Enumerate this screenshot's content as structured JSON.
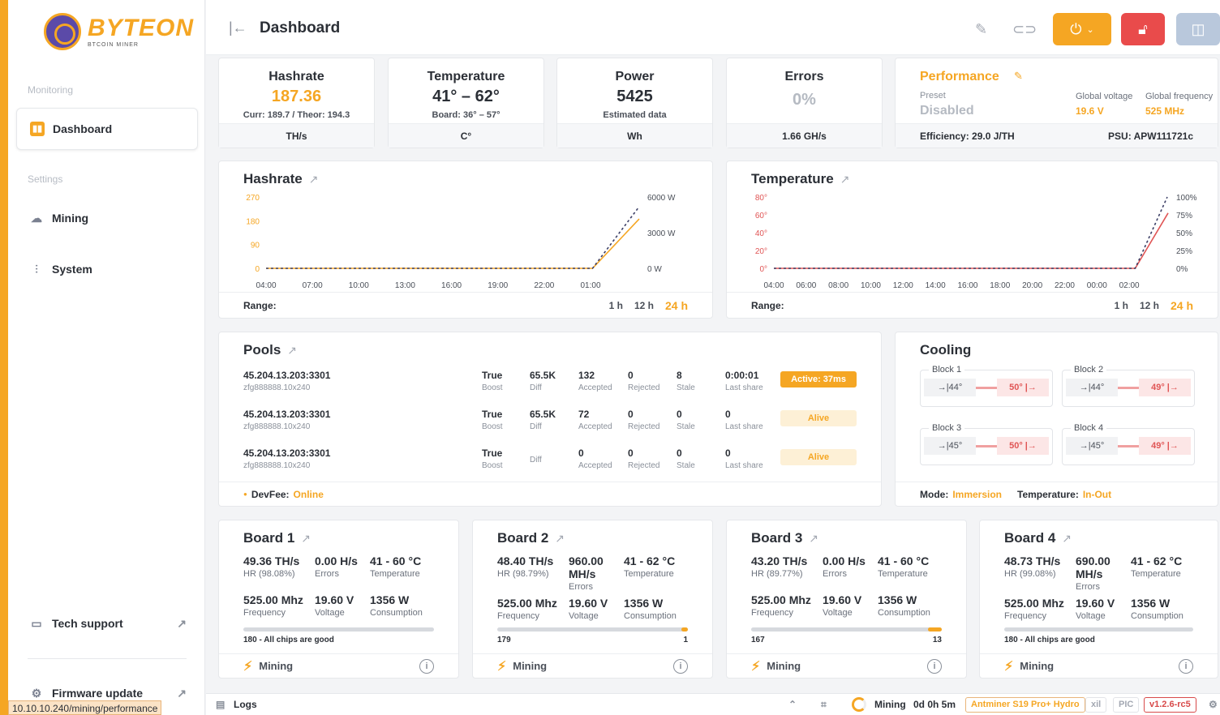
{
  "sidebar": {
    "logo_text": "BYTEON",
    "logo_sub": "BTCOIN MINER",
    "section_monitoring": "Monitoring",
    "section_settings": "Settings",
    "items": [
      {
        "label": "Dashboard",
        "icon": "chart-icon"
      },
      {
        "label": "Mining",
        "icon": "cloud-icon"
      },
      {
        "label": "System",
        "icon": "sliders-icon"
      },
      {
        "label": "Tech support",
        "icon": "chat-icon"
      },
      {
        "label": "Firmware update",
        "icon": "chip-icon"
      }
    ],
    "status_url": "10.10.10.240/mining/performance"
  },
  "header": {
    "title": "Dashboard"
  },
  "stats": {
    "hashrate": {
      "title": "Hashrate",
      "value": "187.36",
      "sub": "Curr: 189.7 / Theor: 194.3",
      "unit": "TH/s"
    },
    "temperature": {
      "title": "Temperature",
      "value": "41° – 62°",
      "sub": "Board: 36° – 57°",
      "unit": "C°"
    },
    "power": {
      "title": "Power",
      "value": "5425",
      "sub": "Estimated data",
      "unit": "Wh"
    },
    "errors": {
      "title": "Errors",
      "value": "0%",
      "unit": "1.66 GH/s"
    },
    "performance": {
      "title": "Performance",
      "preset_label": "Preset",
      "preset_value": "Disabled",
      "gv_label": "Global voltage",
      "gv_value": "19.6 V",
      "gf_label": "Global frequency",
      "gf_value": "525 MHz",
      "efficiency": "Efficiency: 29.0 J/TH",
      "psu": "PSU: APW111721c"
    }
  },
  "hashrate_chart": {
    "title": "Hashrate",
    "range_label": "Range:",
    "ranges": [
      "1 h",
      "12 h",
      "24 h"
    ],
    "chart_data": {
      "type": "line",
      "x": [
        "04:00",
        "07:00",
        "10:00",
        "13:00",
        "16:00",
        "19:00",
        "22:00",
        "01:00"
      ],
      "y_ticks": [
        "270",
        "180",
        "90",
        "0"
      ],
      "y2_ticks": [
        "6000 W",
        "3000 W",
        "0 W"
      ],
      "series": [
        {
          "values": [
            0,
            0,
            0,
            0,
            0,
            0,
            0,
            0,
            187
          ]
        },
        {
          "values": [
            0,
            0,
            0,
            0,
            0,
            0,
            0,
            0,
            5425
          ]
        }
      ],
      "ylim": [
        0,
        270
      ]
    }
  },
  "temperature_chart": {
    "title": "Temperature",
    "range_label": "Range:",
    "ranges": [
      "1 h",
      "12 h",
      "24 h"
    ],
    "chart_data": {
      "type": "line",
      "x": [
        "04:00",
        "06:00",
        "08:00",
        "10:00",
        "12:00",
        "14:00",
        "16:00",
        "18:00",
        "20:00",
        "22:00",
        "00:00",
        "02:00"
      ],
      "y_ticks": [
        "80°",
        "60°",
        "40°",
        "20°",
        "0°"
      ],
      "y2_ticks": [
        "100%",
        "75%",
        "50%",
        "25%",
        "0%"
      ],
      "series": [
        {
          "values": [
            0,
            0,
            0,
            0,
            0,
            0,
            0,
            0,
            0,
            0,
            0,
            0,
            62
          ]
        },
        {
          "values": [
            0,
            0,
            0,
            0,
            0,
            0,
            0,
            0,
            0,
            0,
            0,
            0,
            100
          ]
        }
      ],
      "ylim": [
        0,
        80
      ]
    }
  },
  "pools": {
    "title": "Pools",
    "rows": [
      {
        "url": "45.204.13.203:3301",
        "user": "zfg888888.10x240",
        "boost": "True",
        "boost_l": "Boost",
        "diff": "65.5K",
        "diff_l": "Diff",
        "acc": "132",
        "acc_l": "Accepted",
        "rej": "0",
        "rej_l": "Rejected",
        "stale": "8",
        "stale_l": "Stale",
        "last": "0:00:01",
        "last_l": "Last share",
        "status": "Active: 37ms"
      },
      {
        "url": "45.204.13.203:3301",
        "user": "zfg888888.10x240",
        "boost": "True",
        "boost_l": "Boost",
        "diff": "65.5K",
        "diff_l": "Diff",
        "acc": "72",
        "acc_l": "Accepted",
        "rej": "0",
        "rej_l": "Rejected",
        "stale": "0",
        "stale_l": "Stale",
        "last": "0",
        "last_l": "Last share",
        "status": "Alive"
      },
      {
        "url": "45.204.13.203:3301",
        "user": "zfg888888.10x240",
        "boost": "True",
        "boost_l": "Boost",
        "diff": "",
        "diff_l": "Diff",
        "acc": "0",
        "acc_l": "Accepted",
        "rej": "0",
        "rej_l": "Rejected",
        "stale": "0",
        "stale_l": "Stale",
        "last": "0",
        "last_l": "Last share",
        "status": "Alive"
      }
    ],
    "devfee_label": "DevFee:",
    "devfee_value": "Online"
  },
  "cooling": {
    "title": "Cooling",
    "blocks": [
      {
        "name": "Block 1",
        "in": "→|44°",
        "out": "50° |→"
      },
      {
        "name": "Block 2",
        "in": "→|44°",
        "out": "49° |→"
      },
      {
        "name": "Block 3",
        "in": "→|45°",
        "out": "50° |→"
      },
      {
        "name": "Block 4",
        "in": "→|45°",
        "out": "49° |→"
      }
    ],
    "mode_label": "Mode:",
    "mode_value": "Immersion",
    "temp_label": "Temperature:",
    "temp_value": "In-Out"
  },
  "boards": [
    {
      "title": "Board 1",
      "hr": "49.36 TH/s",
      "hr_l": "HR (98.08%)",
      "err": "0.00 H/s",
      "err_l": "Errors",
      "temp": "41 - 60 °C",
      "temp_l": "Temperature",
      "freq": "525.00 Mhz",
      "freq_l": "Frequency",
      "volt": "19.60 V",
      "volt_l": "Voltage",
      "cons": "1356 W",
      "cons_l": "Consumption",
      "chips_left": "180 - All chips are good",
      "chips_right": "",
      "bad_fraction": 0,
      "status": "Mining"
    },
    {
      "title": "Board 2",
      "hr": "48.40 TH/s",
      "hr_l": "HR (98.79%)",
      "err": "960.00 MH/s",
      "err_l": "Errors",
      "temp": "41 - 62 °C",
      "temp_l": "Temperature",
      "freq": "525.00 Mhz",
      "freq_l": "Frequency",
      "volt": "19.60 V",
      "volt_l": "Voltage",
      "cons": "1356 W",
      "cons_l": "Consumption",
      "chips_left": "179",
      "chips_right": "1",
      "bad_fraction": 0.0056,
      "status": "Mining"
    },
    {
      "title": "Board 3",
      "hr": "43.20 TH/s",
      "hr_l": "HR (89.77%)",
      "err": "0.00 H/s",
      "err_l": "Errors",
      "temp": "41 - 60 °C",
      "temp_l": "Temperature",
      "freq": "525.00 Mhz",
      "freq_l": "Frequency",
      "volt": "19.60 V",
      "volt_l": "Voltage",
      "cons": "1356 W",
      "cons_l": "Consumption",
      "chips_left": "167",
      "chips_right": "13",
      "bad_fraction": 0.072,
      "status": "Mining"
    },
    {
      "title": "Board 4",
      "hr": "48.73 TH/s",
      "hr_l": "HR (99.08%)",
      "err": "690.00 MH/s",
      "err_l": "Errors",
      "temp": "41 - 62 °C",
      "temp_l": "Temperature",
      "freq": "525.00 Mhz",
      "freq_l": "Frequency",
      "volt": "19.60 V",
      "volt_l": "Voltage",
      "cons": "1356 W",
      "cons_l": "Consumption",
      "chips_left": "180 - All chips are good",
      "chips_right": "",
      "bad_fraction": 0,
      "status": "Mining"
    }
  ],
  "bottombar": {
    "logs": "Logs",
    "status": "Mining",
    "uptime": "0d 0h 5m",
    "model": "Antminer S19 Pro+ Hydro",
    "tag1": "xil",
    "tag2": "PIC",
    "version": "v1.2.6-rc5"
  },
  "colors": {
    "accent": "#f5a623",
    "danger": "#e94b4b",
    "chart_hash": "#f5a623",
    "chart_temp": "#e05555"
  }
}
